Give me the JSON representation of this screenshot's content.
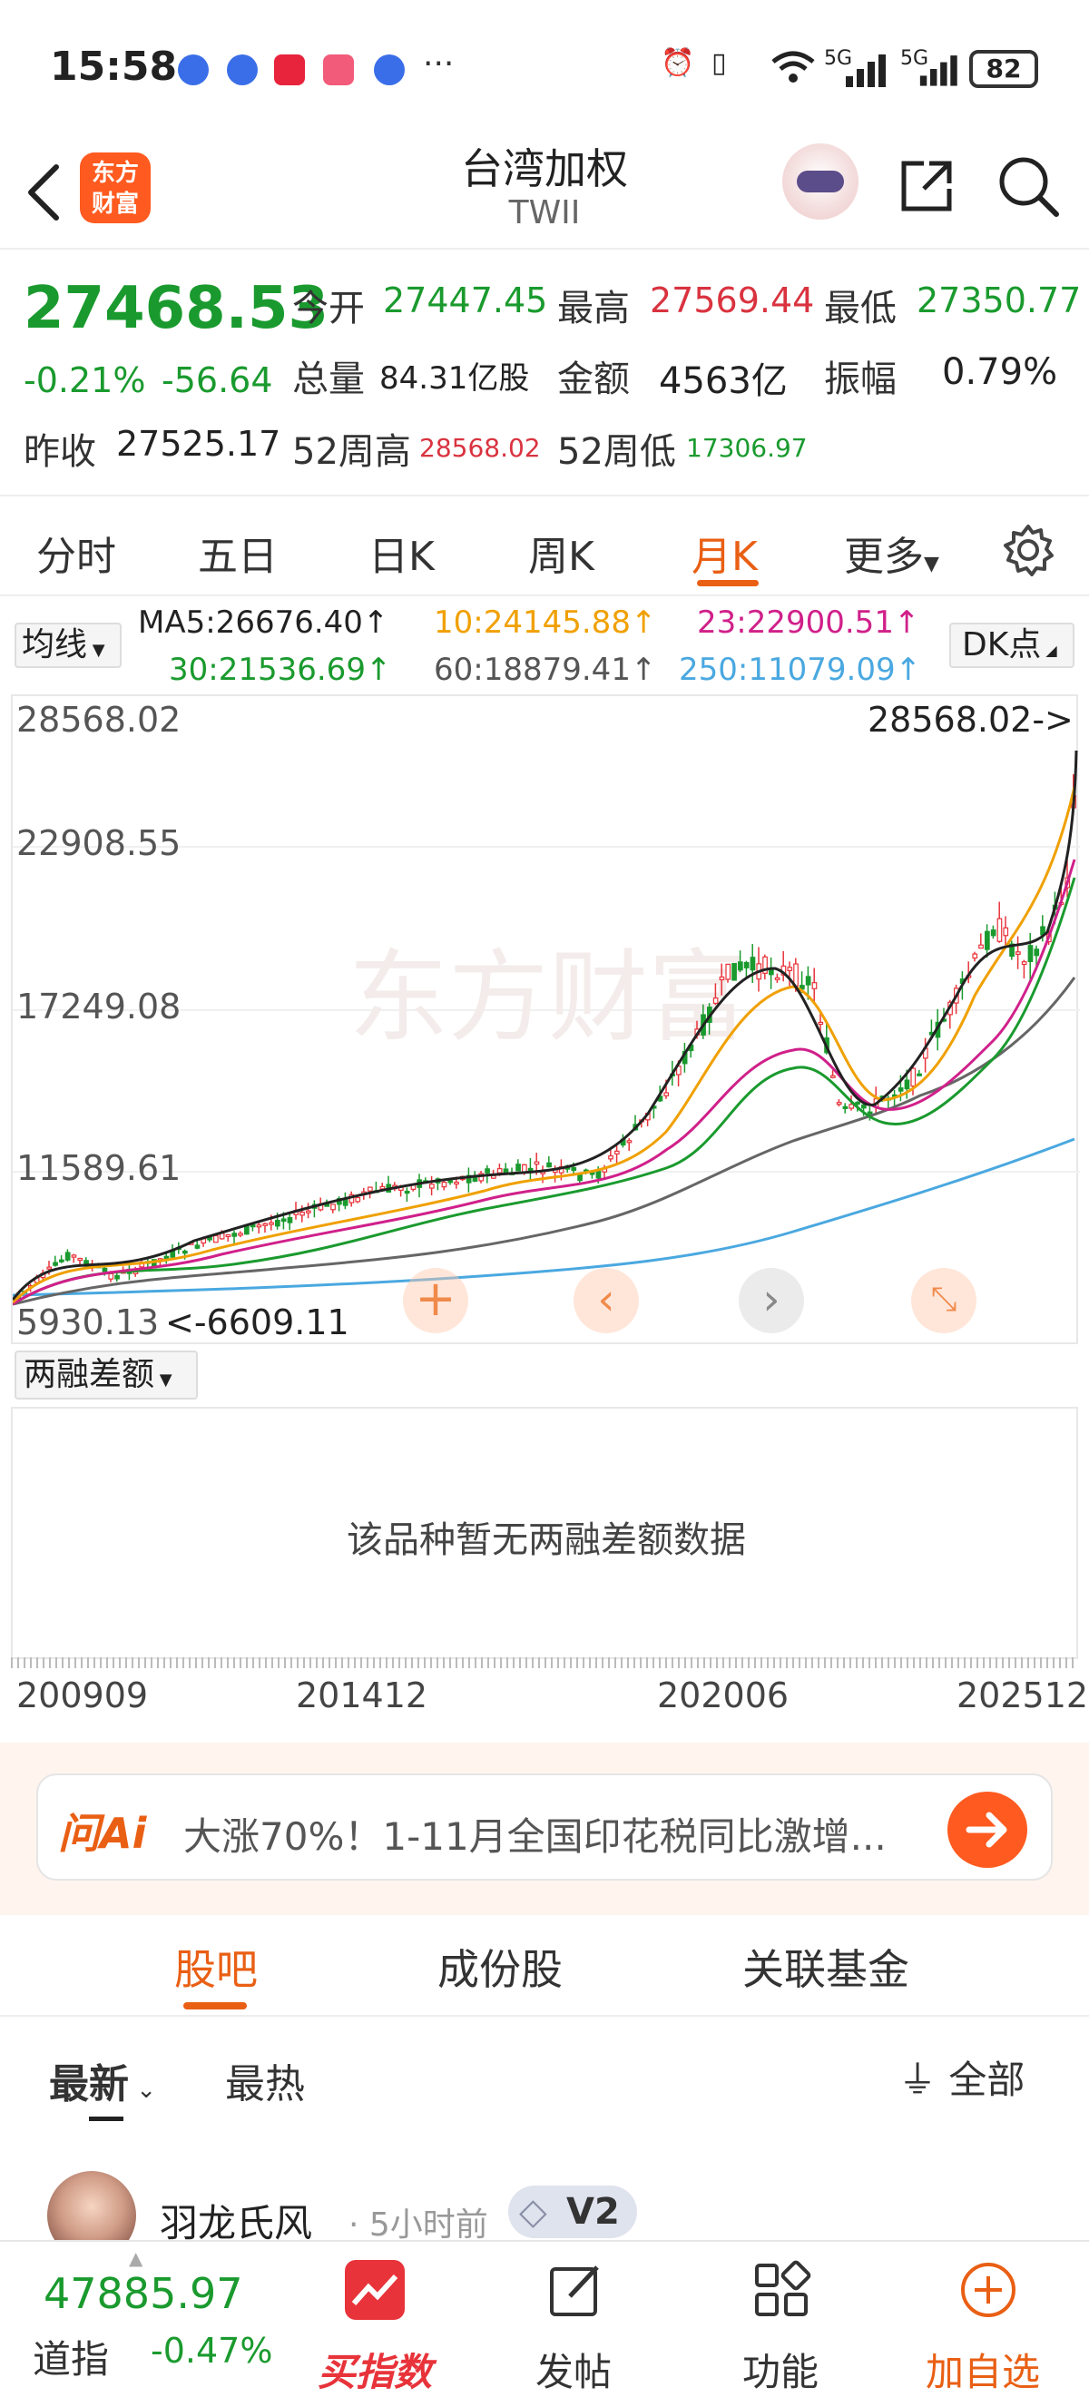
{
  "status_bar": {
    "time": "15:58",
    "more": "···",
    "network": "5G",
    "battery": "82"
  },
  "header": {
    "title": "台湾加权",
    "subtitle": "TWII",
    "logo_text": "东方财富"
  },
  "quote": {
    "price": "27468.53",
    "change_pct": "-0.21%",
    "change_abs": "-56.64",
    "open_label": "今开",
    "open": "27447.45",
    "high_label": "最高",
    "high": "27569.44",
    "low_label": "最低",
    "low": "27350.77",
    "volume_label": "总量",
    "volume": "84.31亿股",
    "amount_label": "金额",
    "amount": "4563亿",
    "amplitude_label": "振幅",
    "amplitude": "0.79%",
    "prev_close_label": "昨收",
    "prev_close": "27525.17",
    "w52_high_label": "52周高",
    "w52_high": "28568.02",
    "w52_low_label": "52周低",
    "w52_low": "17306.97"
  },
  "tabs": [
    "分时",
    "五日",
    "日K",
    "周K",
    "月K",
    "更多"
  ],
  "active_tab": "月K",
  "ma": {
    "selector": "均线",
    "ma5": "MA5:26676.40↑",
    "ma10": "10:24145.88↑",
    "ma23": "23:22900.51↑",
    "ma30": "30:21536.69↑",
    "ma60": "60:18879.41↑",
    "ma250": "250:11079.09↑",
    "dk_selector": "DK点",
    "colors": {
      "ma5": "#222222",
      "ma10": "#f0a000",
      "ma23": "#d0208a",
      "ma30": "#1a9a2e",
      "ma60": "#666666",
      "ma250": "#4aa8e0"
    }
  },
  "chart": {
    "y_labels": [
      "28568.02",
      "22908.55",
      "17249.08",
      "11589.61",
      "5930.13"
    ],
    "max_label": "28568.02->",
    "min_label": "<-6609.11",
    "watermark": "东方财富"
  },
  "margin": {
    "selector": "两融差额",
    "empty_text": "该品种暂无两融差额数据"
  },
  "dates": [
    "200909",
    "201412",
    "202006",
    "202512"
  ],
  "ai": {
    "logo": "问Ai",
    "text": "大涨70%！1-11月全国印花税同比激增..."
  },
  "section_tabs": [
    "股吧",
    "成份股",
    "关联基金"
  ],
  "sort": {
    "latest": "最新",
    "hot": "最热",
    "filter": "全部"
  },
  "post": {
    "user": "羽龙氏风",
    "time": "· 5小时前",
    "badge": "V2"
  },
  "bottom": {
    "dj_value": "47885.97",
    "dj_name": "道指",
    "dj_change": "-0.47%",
    "buy_index": "买指数",
    "post": "发帖",
    "function": "功能",
    "add": "加自选"
  }
}
